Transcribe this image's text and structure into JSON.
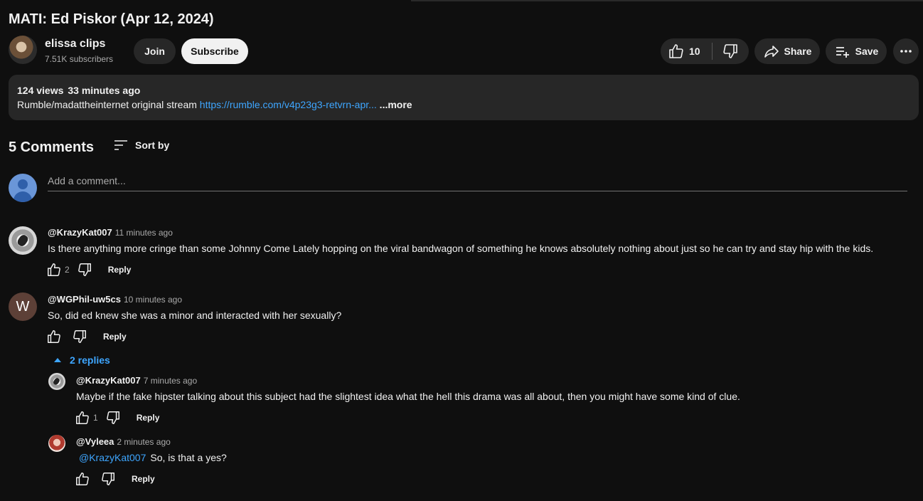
{
  "video": {
    "title": "MATI: Ed Piskor (Apr 12, 2024)",
    "channel_name": "elissa clips",
    "subscribers": "7.51K subscribers",
    "join_label": "Join",
    "subscribe_label": "Subscribe",
    "likes": "10",
    "share_label": "Share",
    "save_label": "Save",
    "views": "124 views",
    "time_ago": "33 minutes ago",
    "description_text": "Rumble/madattheinternet original stream ",
    "description_link": "https://rumble.com/v4p23g3-retvrn-apr...",
    "more_label": " ...more"
  },
  "comments_section": {
    "count_label": "5 Comments",
    "sort_label": "Sort by",
    "add_placeholder": "Add a comment...",
    "reply_label": "Reply",
    "replies_toggle": "2 replies"
  },
  "comments": [
    {
      "handle": "@KrazyKat007",
      "time": "11 minutes ago",
      "text": "Is there anything more cringe than some Johnny Come Lately hopping on the viral bandwagon of something he knows absolutely nothing about just so he can try and stay hip with the kids.",
      "likes": "2"
    },
    {
      "handle": "@WGPhil-uw5cs",
      "avatar_letter": "W",
      "time": "10 minutes ago",
      "text": "So, did ed knew she was a minor and interacted with her sexually?",
      "likes": ""
    }
  ],
  "replies": [
    {
      "handle": "@KrazyKat007",
      "time": "7 minutes ago",
      "text": "Maybe if the fake hipster talking about this subject had the slightest idea what the hell this drama was all about, then you might have some kind of clue.",
      "likes": "1"
    },
    {
      "handle": "@Vyleea",
      "time": "2 minutes ago",
      "mention": "@KrazyKat007",
      "text": "So, is that a yes?",
      "likes": ""
    }
  ],
  "colors": {
    "background": "#0f0f0f",
    "surface": "#272727",
    "link": "#3ea6ff",
    "secondary_text": "#aaaaaa"
  }
}
